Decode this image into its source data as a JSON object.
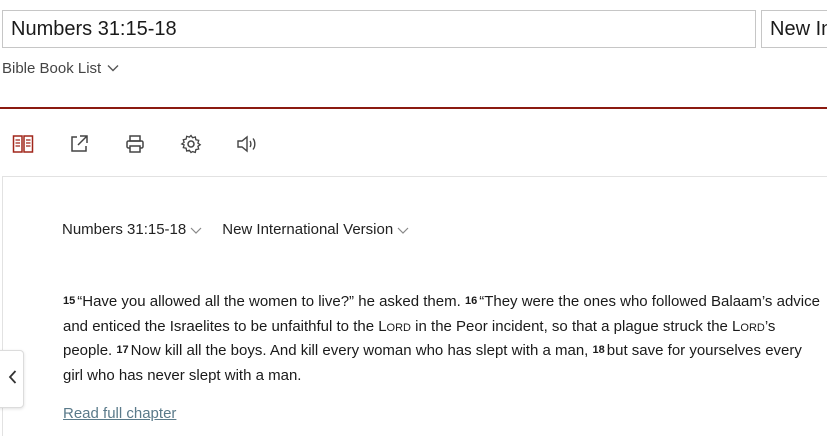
{
  "search": {
    "value": "Numbers 31:15-18"
  },
  "version_box": {
    "value": "New International Version"
  },
  "book_list": {
    "label": "Bible Book List"
  },
  "colors": {
    "accent_rule": "#8b1a10",
    "icon_red": "#a1261a",
    "link": "#5a7a8a"
  },
  "toolbar": {
    "icons": [
      "parallel-icon",
      "share-icon",
      "print-icon",
      "gear-icon",
      "speaker-icon"
    ]
  },
  "passage_header": {
    "reference": "Numbers 31:15-18",
    "version": "New International Version"
  },
  "passage": {
    "v15_num": "15",
    "v15_text": "“Have you allowed all the women to live?” he asked them.",
    "v16_num": "16",
    "v16_text_a": "“They were the ones who followed Balaam’s advice and enticed the Israelites to be unfaithful to the ",
    "lord_1": "Lord",
    "v16_text_b": " in the Peor incident, so that a plague struck the ",
    "lord_2": "Lord",
    "v16_text_c": "’s people.",
    "v17_num": "17",
    "v17_text": "Now kill all the boys. And kill every woman who has slept with a man,",
    "v18_num": "18",
    "v18_text": "but save for yourselves every girl who has never slept with a man."
  },
  "read_full_chapter": "Read full chapter"
}
